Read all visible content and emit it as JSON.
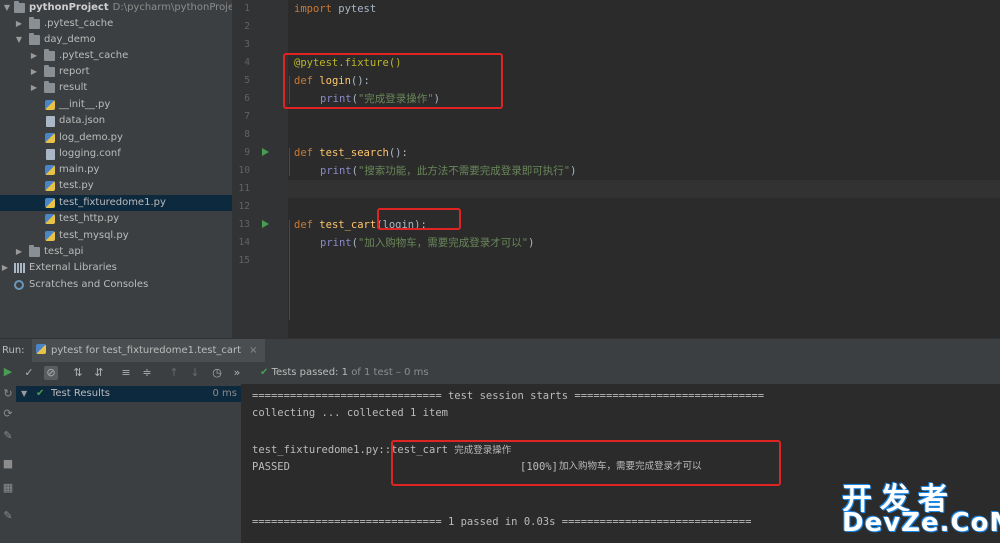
{
  "project_tree": {
    "rows": [
      {
        "label": "pythonProject",
        "path": "D:\\pycharm\\pythonProject"
      },
      {
        "label": ".pytest_cache"
      },
      {
        "label": "day_demo"
      },
      {
        "label": ".pytest_cache"
      },
      {
        "label": "report"
      },
      {
        "label": "result"
      },
      {
        "label": "__init__.py"
      },
      {
        "label": "data.json"
      },
      {
        "label": "log_demo.py"
      },
      {
        "label": "logging.conf"
      },
      {
        "label": "main.py"
      },
      {
        "label": "test.py"
      },
      {
        "label": "test_fixturedome1.py"
      },
      {
        "label": "test_http.py"
      },
      {
        "label": "test_mysql.py"
      },
      {
        "label": "test_api"
      },
      {
        "label": "External Libraries"
      },
      {
        "label": "Scratches and Consoles"
      }
    ]
  },
  "editor": {
    "line_numbers": [
      "1",
      "2",
      "3",
      "4",
      "5",
      "6",
      "7",
      "8",
      "9",
      "10",
      "11",
      "12",
      "13",
      "14",
      "15"
    ],
    "code": {
      "l1_kw": "import",
      "l1_rest": " pytest",
      "l5_deco": "@pytest.fixture()",
      "l6_kw": "def",
      "l6_fn": "login",
      "l6_rest": "():",
      "l7_bi": "print",
      "l7_open": "(",
      "l7_str": "\"完成登录操作\"",
      "l7_close": ")",
      "l10_kw": "def",
      "l10_fn": "test_search",
      "l10_rest": "():",
      "l11_bi": "print",
      "l11_open": "(",
      "l11_str": "\"搜索功能，此方法不需要完成登录即可执行\"",
      "l11_close": ")",
      "l14_kw": "def",
      "l14_fn": "test_cart",
      "l14_rest": "(login):",
      "l15_bi": "print",
      "l15_open": "(",
      "l15_str": "\"加入购物车，需要完成登录才可以\"",
      "l15_close": ")"
    }
  },
  "run_panel": {
    "run_label": "Run:",
    "tab_label": "pytest for test_fixturedome1.test_cart",
    "tests_passed_bold": "Tests passed:",
    "tests_passed_count": "1",
    "tests_passed_detail": "of 1 test – 0 ms",
    "results_label": "Test Results",
    "results_time": "0 ms",
    "console": {
      "line1": "============================== test session starts ==============================",
      "line2": "collecting ... collected 1 item",
      "line3_a": "test_fixturedome1.py::",
      "line3_b": "test_cart ",
      "line3_c": "完成登录操作",
      "line4_a": "PASSED",
      "line4_b": "[100%]",
      "line4_c": "加入购物车，需要完成登录才可以",
      "line5": "============================== 1 passed in 0.03s =============================="
    }
  },
  "watermark": {
    "top": "开发者",
    "bottom": "DevZe.CoM"
  }
}
